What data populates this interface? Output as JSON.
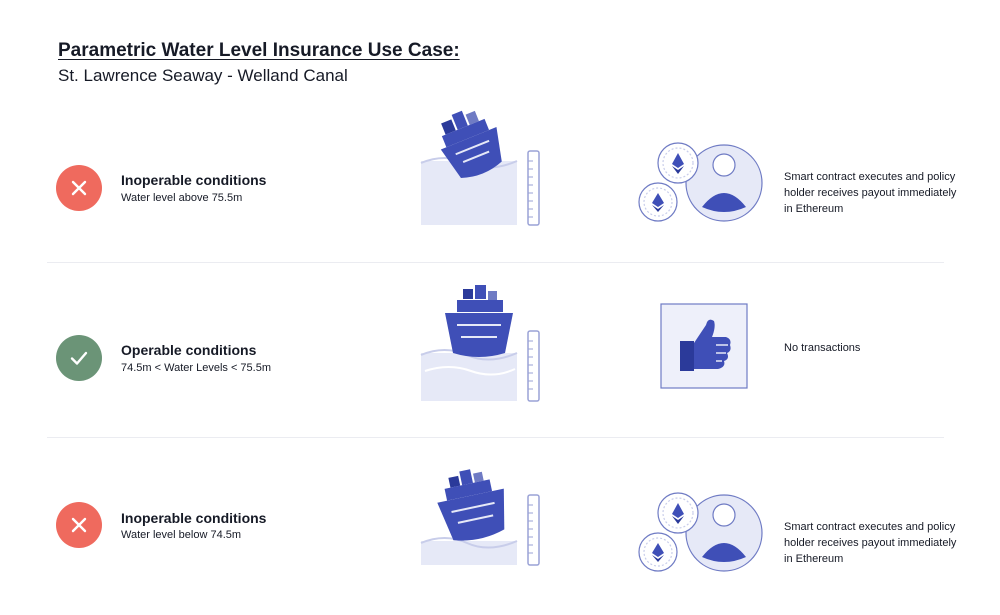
{
  "header": {
    "title": "Parametric Water Level Insurance Use Case:",
    "subtitle": "St. Lawrence Seaway - Welland Canal"
  },
  "rows": [
    {
      "status": "inoperable",
      "status_icon": "x-icon",
      "status_color": "#ef6a5e",
      "title": "Inoperable conditions",
      "condition": "Water level above 75.5m",
      "outcome_icon": "ethereum-payout-icon",
      "outcome": "Smart contract executes and policy holder receives payout immediately in Ethereum"
    },
    {
      "status": "operable",
      "status_icon": "check-icon",
      "status_color": "#6b9477",
      "title": "Operable conditions",
      "condition": "74.5m < Water Levels < 75.5m",
      "outcome_icon": "thumbs-up-icon",
      "outcome": "No transactions"
    },
    {
      "status": "inoperable",
      "status_icon": "x-icon",
      "status_color": "#ef6a5e",
      "title": "Inoperable conditions",
      "condition": "Water level below 74.5m",
      "outcome_icon": "ethereum-payout-icon",
      "outcome": "Smart contract executes and policy holder receives payout immediately in Ethereum"
    }
  ],
  "colors": {
    "ship": "#3f4fb7",
    "ship_dark": "#2b3a9a",
    "water": "#e6e9f7",
    "outline": "#6f7bc4"
  }
}
